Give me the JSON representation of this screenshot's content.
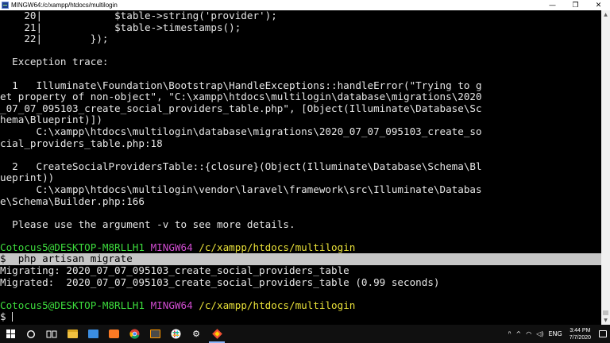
{
  "window": {
    "title": "MINGW64:/c/xampp/htdocs/multilogin",
    "minimize_glyph": "—",
    "maximize_glyph": "❐",
    "close_glyph": "✕"
  },
  "terminal": {
    "code_lines": [
      {
        "num": "20|",
        "code": "            $table->string('provider');"
      },
      {
        "num": "21|",
        "code": "            $table->timestamps();"
      },
      {
        "num": "22|",
        "code": "        });"
      }
    ],
    "exception_header": "  Exception trace:",
    "trace": [
      {
        "lines": [
          "  1   Illuminate\\Foundation\\Bootstrap\\HandleExceptions::handleError(\"Trying to g",
          "et property of non-object\", \"C:\\xampp\\htdocs\\multilogin\\database\\migrations\\2020",
          "_07_07_095103_create_social_providers_table.php\", [Object(Illuminate\\Database\\Sc",
          "hema\\Blueprint)])",
          "      C:\\xampp\\htdocs\\multilogin\\database\\migrations\\2020_07_07_095103_create_so",
          "cial_providers_table.php:18"
        ]
      },
      {
        "lines": [
          "  2   CreateSocialProvidersTable::{closure}(Object(Illuminate\\Database\\Schema\\Bl",
          "ueprint))",
          "      C:\\xampp\\htdocs\\multilogin\\vendor\\laravel\\framework\\src\\Illuminate\\Databas",
          "e\\Schema\\Builder.php:166"
        ]
      }
    ],
    "hint": "  Please use the argument -v to see more details.",
    "prompt": {
      "user_host": "Cotocus5@DESKTOP-M8RLLH1",
      "shell": "MINGW64",
      "path": "/c/xampp/htdocs/multilogin"
    },
    "command": "$  php artisan migrate",
    "output": [
      "Migrating: 2020_07_07_095103_create_social_providers_table",
      "Migrated:  2020_07_07_095103_create_social_providers_table (0.99 seconds)"
    ],
    "prompt2": {
      "user_host": "Cotocus5@DESKTOP-M8RLLH1",
      "shell": "MINGW64",
      "path": "/c/xampp/htdocs/multilogin"
    },
    "cursor_prompt": "$ "
  },
  "taskbar": {
    "icons": [
      "windows-start-icon",
      "cortana-icon",
      "task-view-icon",
      "file-explorer-icon",
      "photos-icon",
      "xampp-icon",
      "chrome-icon",
      "sublime-text-icon",
      "slack-icon",
      "settings-icon",
      "git-bash-icon"
    ],
    "tray": {
      "people_glyph": "ᴿ",
      "chevron_glyph": "^",
      "network_glyph": "◠",
      "volume_glyph": "◁)",
      "language": "ENG",
      "time": "3:44 PM",
      "date": "7/7/2020"
    }
  },
  "colors": {
    "prompt_user": "#3ddc3d",
    "prompt_shell": "#d04cd0",
    "prompt_path": "#e8e039",
    "selection": "#c6c6c6",
    "terminal_bg": "#000000"
  }
}
